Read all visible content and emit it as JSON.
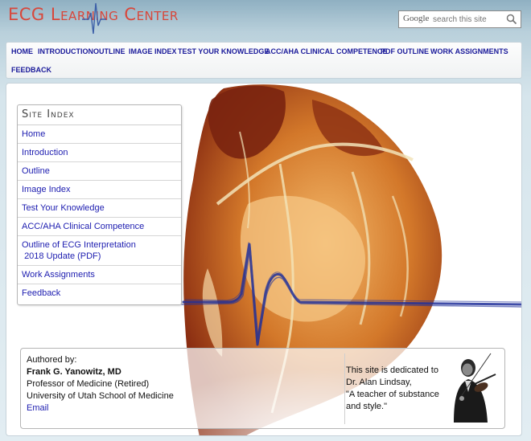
{
  "header": {
    "logo_text": "ECG Learning Center",
    "search": {
      "brand": "Google",
      "placeholder": "search this site"
    }
  },
  "nav": {
    "items": [
      "HOME",
      "INTRODUCTION",
      "OUTLINE",
      "IMAGE INDEX",
      "TEST YOUR KNOWLEDGE",
      "ACC/AHA CLINICAL COMPETENCE",
      "PDF OUTLINE",
      "WORK ASSIGNMENTS",
      "FEEDBACK"
    ]
  },
  "site_index": {
    "title": "Site Index",
    "items": [
      {
        "label": "Home"
      },
      {
        "label": "Introduction"
      },
      {
        "label": "Outline"
      },
      {
        "label": "Image Index"
      },
      {
        "label": "Test Your Knowledge"
      },
      {
        "label": "ACC/AHA Clinical Competence"
      },
      {
        "label": "Outline of ECG Interpretation",
        "label2": "2018 Update (PDF)"
      },
      {
        "label": "Work Assignments"
      },
      {
        "label": "Feedback"
      }
    ]
  },
  "author": {
    "heading": "Authored by:",
    "name": "Frank G. Yanowitz, MD",
    "title": "Professor of Medicine (Retired)",
    "affiliation": "University of Utah School of Medicine",
    "email_label": "Email"
  },
  "dedication": {
    "line1": "This site is dedicated to",
    "line2": "Dr. Alan Lindsay,",
    "line3": "\"A teacher of substance",
    "line4": "and style.\""
  },
  "colors": {
    "link": "#1d1db0",
    "nav_link": "#1a1a9a",
    "logo": "#d8473b",
    "ecg_trace": "#1f2f9a",
    "heart_dark": "#7a2410",
    "heart_mid": "#c8641e",
    "heart_light": "#f0b25a"
  }
}
